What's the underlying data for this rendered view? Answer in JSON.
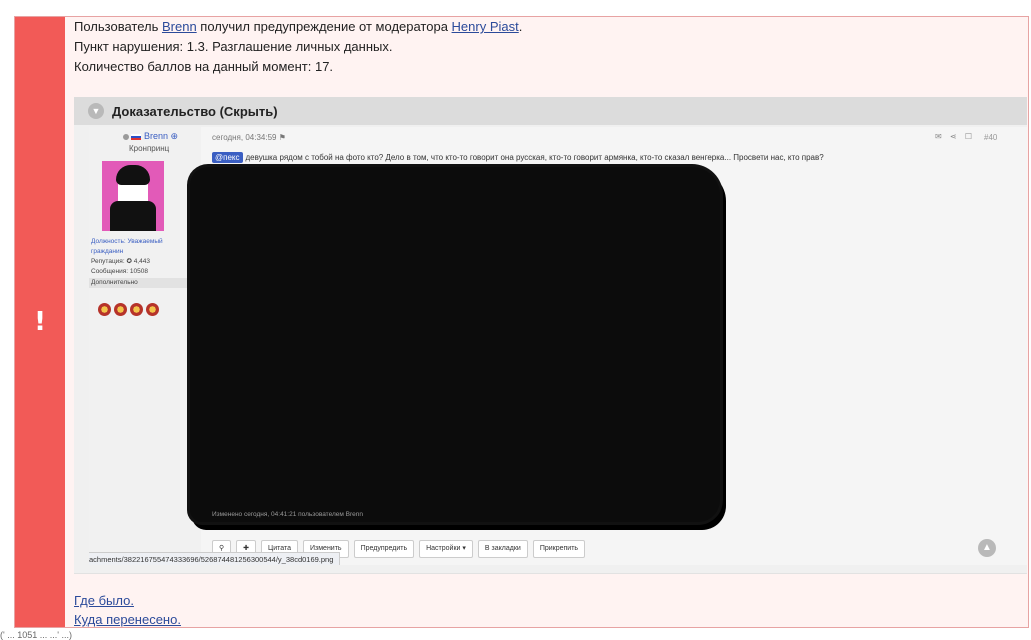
{
  "warning": {
    "line1_prefix": "Пользователь ",
    "user_link": "Brenn",
    "line1_middle": " получил предупреждение от модератора ",
    "moderator_link": "Henry Piast",
    "line1_suffix": ".",
    "line2": "Пункт нарушения: 1.3. Разглашение личных данных.",
    "line3": "Количество баллов на данный момент: 17.",
    "stripe_icon": "!",
    "stripe_color": "#f25a57"
  },
  "spoiler": {
    "title": "Доказательство (Скрыть)",
    "toggle_icon": "chevron-down-icon"
  },
  "evidence": {
    "username": "Brenn",
    "rank": "Кронпринц",
    "info": {
      "position_label": "Должность: Уважаемый",
      "position_cont": "гражданин",
      "reputation": "Репутация: ✪ 4,443",
      "messages": "Сообщения: 10508",
      "more": "Дополнительно"
    },
    "date": "сегодня, 04:34:59",
    "post_number": "#40",
    "mention": "@пекс",
    "message": "девушка рядом с тобой на фото кто? Дело в том, что кто-то говорит она русская, кто-то говорит армянка, кто-то сказал венгерка... Просвети нас, кто прав?",
    "edited": "Изменено сегодня, 04:41:21 пользователем Brenn",
    "buttons": [
      "Цитата",
      "Изменить",
      "Предупредить",
      "Настройки ▾",
      "В закладки",
      "Прикрепить"
    ],
    "url": "achments/382216755474333696/526874481256300544/y_38cd0169.png"
  },
  "links": {
    "where_was": "Где было.",
    "moved_to": "Куда перенесено."
  },
  "bottom_status": "(' ... 1051 ... ...' ...)"
}
